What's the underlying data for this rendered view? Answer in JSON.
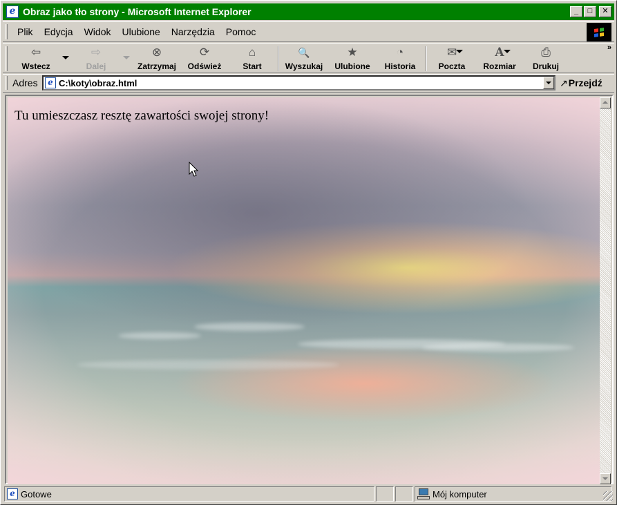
{
  "window": {
    "title": "Obraz jako tło strony - Microsoft Internet Explorer",
    "buttons": {
      "minimize": "_",
      "maximize": "□",
      "close": "✕"
    }
  },
  "menu": {
    "items": [
      {
        "label": "Plik",
        "name": "menu-plik"
      },
      {
        "label": "Edycja",
        "name": "menu-edycja"
      },
      {
        "label": "Widok",
        "name": "menu-widok"
      },
      {
        "label": "Ulubione",
        "name": "menu-ulubione"
      },
      {
        "label": "Narzędzia",
        "name": "menu-narzedzia"
      },
      {
        "label": "Pomoc",
        "name": "menu-pomoc"
      }
    ]
  },
  "toolbar": {
    "back": {
      "label": "Wstecz",
      "icon": "back-arrow-icon",
      "glyph": "⇦"
    },
    "forward": {
      "label": "Dalej",
      "icon": "forward-arrow-icon",
      "glyph": "⇨"
    },
    "stop": {
      "label": "Zatrzymaj",
      "icon": "stop-icon",
      "glyph": "⊗"
    },
    "refresh": {
      "label": "Odśwież",
      "icon": "refresh-icon",
      "glyph": "⟳"
    },
    "home": {
      "label": "Start",
      "icon": "home-icon",
      "glyph": "⌂"
    },
    "search": {
      "label": "Wyszukaj",
      "icon": "search-icon",
      "glyph": "🔍"
    },
    "favorites": {
      "label": "Ulubione",
      "icon": "favorites-icon",
      "glyph": "★"
    },
    "history": {
      "label": "Historia",
      "icon": "history-icon",
      "glyph": "◔"
    },
    "mail": {
      "label": "Poczta",
      "icon": "mail-icon",
      "glyph": "✉"
    },
    "size": {
      "label": "Rozmiar",
      "icon": "font-size-icon",
      "glyph": "A"
    },
    "print": {
      "label": "Drukuj",
      "icon": "print-icon",
      "glyph": "⎙"
    },
    "more": "»"
  },
  "address": {
    "label": "Adres",
    "value": "C:\\koty\\obraz.html",
    "go_label": "Przejdź",
    "go_glyph": "↗"
  },
  "page": {
    "text": "Tu umieszczasz resztę zawartości swojej strony!"
  },
  "status": {
    "text": "Gotowe",
    "zone": "Mój komputer"
  },
  "colors": {
    "titlebar": "#008000",
    "chrome": "#d4d0c8"
  }
}
